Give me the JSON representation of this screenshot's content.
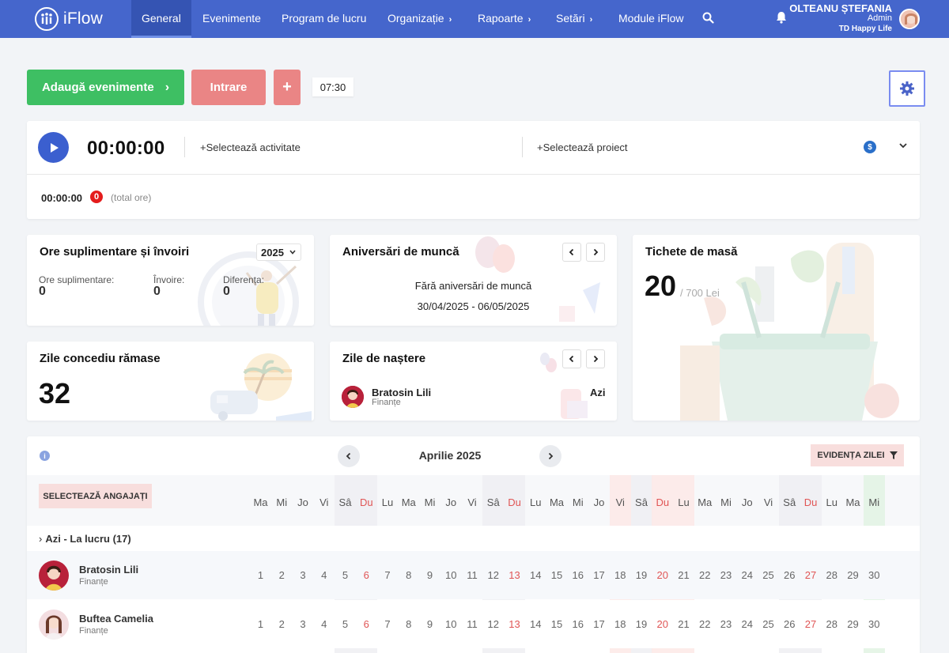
{
  "app": {
    "logo_text": "iFlow",
    "nav": [
      {
        "label": "General",
        "active": true
      },
      {
        "label": "Evenimente"
      },
      {
        "label": "Program de lucru"
      },
      {
        "label": "Organizație",
        "has_chevron": true
      },
      {
        "label": "Rapoarte",
        "has_chevron": true
      },
      {
        "label": "Setări",
        "has_chevron": true
      },
      {
        "label": "Module iFlow"
      }
    ],
    "user": {
      "name": "OLTEANU ȘTEFANIA",
      "role": "Admin",
      "company": "TD Happy Life"
    },
    "colors": {
      "nav_bg": "#4566cc",
      "green": "#3ebf63",
      "red_btn": "#ea8585",
      "accent_blue": "#3b5fcf"
    }
  },
  "actions": {
    "add_events": "Adaugă evenimente",
    "check_in": "Intrare",
    "plus": "+",
    "clock": "07:30"
  },
  "timer": {
    "elapsed": "00:00:00",
    "select_activity": "Selectează activitate",
    "select_project": "Selectează proiect",
    "total_time": "00:00:00",
    "total_count": "0",
    "total_label": "(total ore)"
  },
  "overtime": {
    "title": "Ore suplimentare și învoiri",
    "year": "2025",
    "stats": [
      {
        "label": "Ore suplimentare:",
        "value": "0"
      },
      {
        "label": "Învoire:",
        "value": "0"
      },
      {
        "label": "Diferența:",
        "value": "0"
      }
    ]
  },
  "anniversaries": {
    "title": "Aniversări de muncă",
    "empty": "Fără aniversări de muncă",
    "range": "30/04/2025 - 06/05/2025"
  },
  "meal_tickets": {
    "title": "Tichete de masă",
    "count": "20",
    "value": "/ 700 Lei"
  },
  "leave": {
    "title": "Zile concediu rămase",
    "days": "32"
  },
  "birthdays": {
    "title": "Zile de naștere",
    "people": [
      {
        "name": "Bratosin Lili",
        "dept": "Finanțe",
        "when": "Azi"
      }
    ]
  },
  "calendar": {
    "month": "Aprilie 2025",
    "evidence_button": "EVIDENȚA ZILEI",
    "select_employees": "SELECTEAZĂ ANGAJAȚI",
    "group_label": "Azi - La lucru (17)",
    "days": [
      {
        "d": "Ma",
        "n": "1"
      },
      {
        "d": "Mi",
        "n": "2"
      },
      {
        "d": "Jo",
        "n": "3"
      },
      {
        "d": "Vi",
        "n": "4"
      },
      {
        "d": "Sâ",
        "n": "5",
        "type": "weekend"
      },
      {
        "d": "Du",
        "n": "6",
        "type": "sunday"
      },
      {
        "d": "Lu",
        "n": "7"
      },
      {
        "d": "Ma",
        "n": "8"
      },
      {
        "d": "Mi",
        "n": "9"
      },
      {
        "d": "Jo",
        "n": "10"
      },
      {
        "d": "Vi",
        "n": "11"
      },
      {
        "d": "Sâ",
        "n": "12",
        "type": "weekend"
      },
      {
        "d": "Du",
        "n": "13",
        "type": "sunday"
      },
      {
        "d": "Lu",
        "n": "14"
      },
      {
        "d": "Ma",
        "n": "15"
      },
      {
        "d": "Mi",
        "n": "16"
      },
      {
        "d": "Jo",
        "n": "17"
      },
      {
        "d": "Vi",
        "n": "18",
        "type": "holiday"
      },
      {
        "d": "Sâ",
        "n": "19",
        "type": "weekend"
      },
      {
        "d": "Du",
        "n": "20",
        "type": "holiday-sunday"
      },
      {
        "d": "Lu",
        "n": "21",
        "type": "holiday"
      },
      {
        "d": "Ma",
        "n": "22"
      },
      {
        "d": "Mi",
        "n": "23"
      },
      {
        "d": "Jo",
        "n": "24"
      },
      {
        "d": "Vi",
        "n": "25"
      },
      {
        "d": "Sâ",
        "n": "26",
        "type": "weekend"
      },
      {
        "d": "Du",
        "n": "27",
        "type": "sunday"
      },
      {
        "d": "Lu",
        "n": "28"
      },
      {
        "d": "Ma",
        "n": "29"
      },
      {
        "d": "Mi",
        "n": "30",
        "type": "today"
      }
    ],
    "employees": [
      {
        "name": "Bratosin Lili",
        "dept": "Finanțe"
      },
      {
        "name": "Buftea Camelia",
        "dept": "Finanțe"
      }
    ]
  }
}
